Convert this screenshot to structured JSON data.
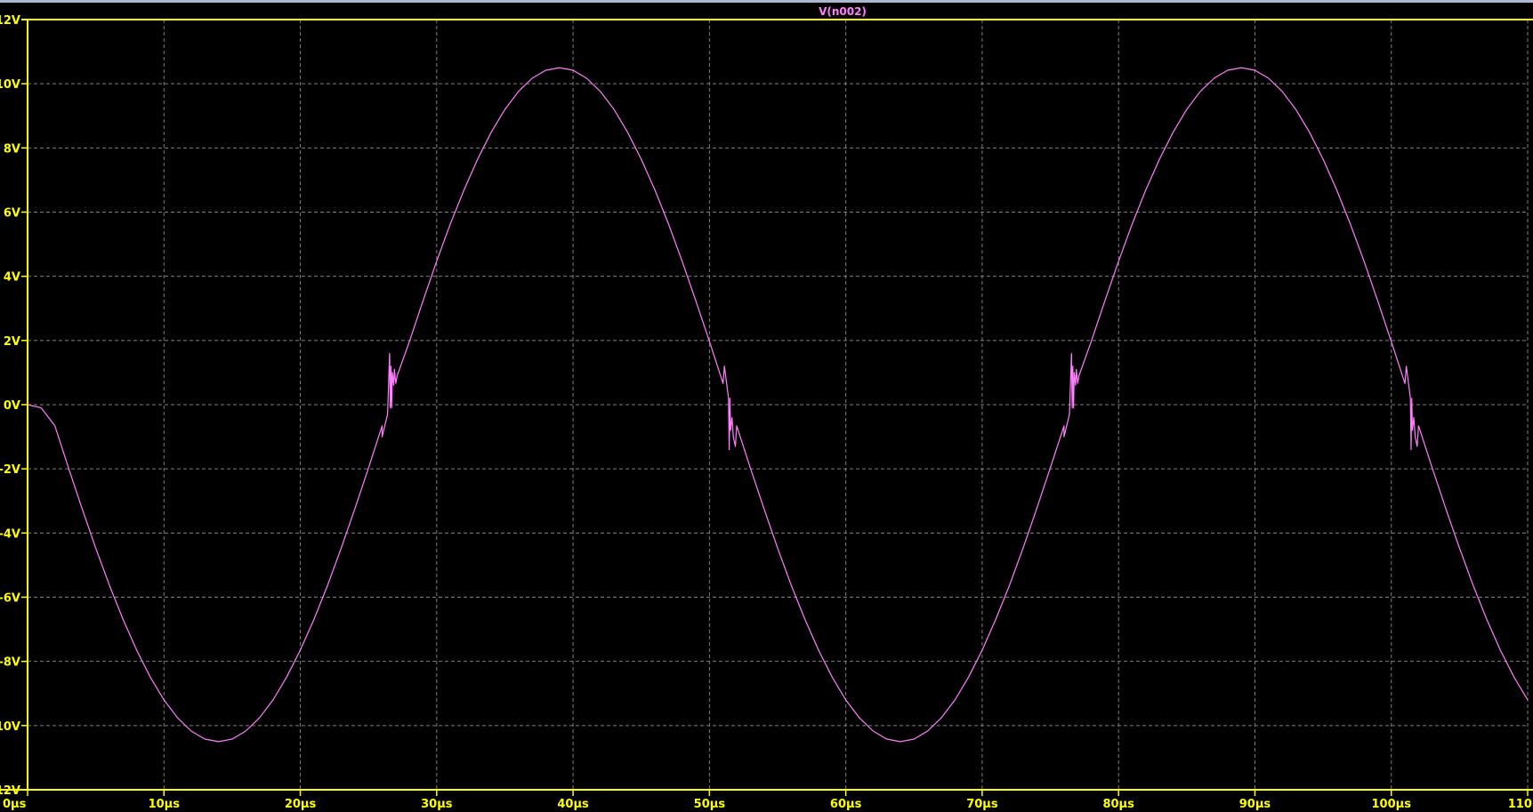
{
  "chart_data": {
    "type": "line",
    "title": "V(n002)",
    "xlabel": "",
    "ylabel": "",
    "xlim": [
      0,
      110
    ],
    "ylim": [
      -12,
      12
    ],
    "x_unit": "µs",
    "y_unit": "V",
    "grid": true,
    "xticks": [
      "0µs",
      "10µs",
      "20µs",
      "30µs",
      "40µs",
      "50µs",
      "60µs",
      "70µs",
      "80µs",
      "90µs",
      "100µs",
      "110µs"
    ],
    "xtick_values": [
      0,
      10,
      20,
      30,
      40,
      50,
      60,
      70,
      80,
      90,
      100,
      110
    ],
    "yticks": [
      "12V",
      "10V",
      "8V",
      "6V",
      "4V",
      "2V",
      "0V",
      "-2V",
      "-4V",
      "-6V",
      "-8V",
      "-10V",
      "-12V"
    ],
    "ytick_values": [
      12,
      10,
      8,
      6,
      4,
      2,
      0,
      -2,
      -4,
      -6,
      -8,
      -10,
      -12
    ],
    "colors": {
      "axis": "#ffff00",
      "grid": "#808080",
      "trace": "#ff80ff",
      "background": "#000000"
    },
    "series": [
      {
        "name": "V(n002)",
        "x_start": 0,
        "x_step": 1,
        "values": [
          0,
          -0.1,
          -0.66,
          -1.97,
          -3.24,
          -4.47,
          -5.63,
          -6.69,
          -7.65,
          -8.49,
          -9.2,
          -9.76,
          -10.17,
          -10.42,
          -10.5,
          -10.42,
          -10.17,
          -9.76,
          -9.2,
          -8.49,
          -7.65,
          -6.69,
          -5.63,
          -4.47,
          -3.24,
          -1.97,
          -0.66,
          0.66,
          1.97,
          3.24,
          4.47,
          5.63,
          6.69,
          7.65,
          8.49,
          9.2,
          9.76,
          10.17,
          10.42,
          10.5,
          10.42,
          10.17,
          9.76,
          9.2,
          8.49,
          7.65,
          6.69,
          5.63,
          4.47,
          3.24,
          1.97,
          0.66,
          -0.66,
          -1.97,
          -3.24,
          -4.47,
          -5.63,
          -6.69,
          -7.65,
          -8.49,
          -9.2,
          -9.76,
          -10.17,
          -10.42,
          -10.5,
          -10.42,
          -10.17,
          -9.76,
          -9.2,
          -8.49,
          -7.65,
          -6.69,
          -5.63,
          -4.47,
          -3.24,
          -1.97,
          -0.66,
          0.66,
          1.97,
          3.24,
          4.47,
          5.63,
          6.69,
          7.65,
          8.49,
          9.2,
          9.76,
          10.17,
          10.42,
          10.5,
          10.42,
          10.17,
          9.76,
          9.2,
          8.49,
          7.65,
          6.69,
          5.63,
          4.47,
          3.24,
          1.97,
          0.66,
          -0.66,
          -1.97,
          -3.24,
          -4.47,
          -5.63,
          -6.69,
          -7.65,
          -8.49,
          -9.2
        ],
        "glitches": [
          [
            26.0,
            -1.0
          ],
          [
            26.4,
            -0.3
          ],
          [
            26.55,
            1.6
          ],
          [
            26.6,
            -0.1
          ],
          [
            26.65,
            1.2
          ],
          [
            26.7,
            -0.1
          ],
          [
            26.75,
            1.0
          ],
          [
            26.85,
            0.6
          ],
          [
            26.9,
            1.1
          ],
          [
            27.1,
            0.9
          ],
          [
            51.1,
            1.2
          ],
          [
            51.25,
            0.7
          ],
          [
            51.4,
            0.2
          ],
          [
            51.45,
            -1.4
          ],
          [
            51.5,
            0.2
          ],
          [
            51.55,
            -0.8
          ],
          [
            51.65,
            -0.4
          ],
          [
            51.75,
            -1.0
          ],
          [
            51.9,
            -1.3
          ],
          [
            76.0,
            -1.0
          ],
          [
            76.4,
            -0.3
          ],
          [
            76.55,
            1.6
          ],
          [
            76.6,
            -0.1
          ],
          [
            76.65,
            1.2
          ],
          [
            76.7,
            -0.1
          ],
          [
            76.75,
            1.0
          ],
          [
            76.85,
            0.6
          ],
          [
            76.9,
            1.1
          ],
          [
            77.1,
            0.9
          ],
          [
            101.1,
            1.2
          ],
          [
            101.25,
            0.7
          ],
          [
            101.4,
            0.2
          ],
          [
            101.45,
            -1.4
          ],
          [
            101.5,
            0.2
          ],
          [
            101.55,
            -0.8
          ],
          [
            101.65,
            -0.4
          ],
          [
            101.75,
            -1.0
          ],
          [
            101.9,
            -1.3
          ]
        ]
      }
    ]
  }
}
